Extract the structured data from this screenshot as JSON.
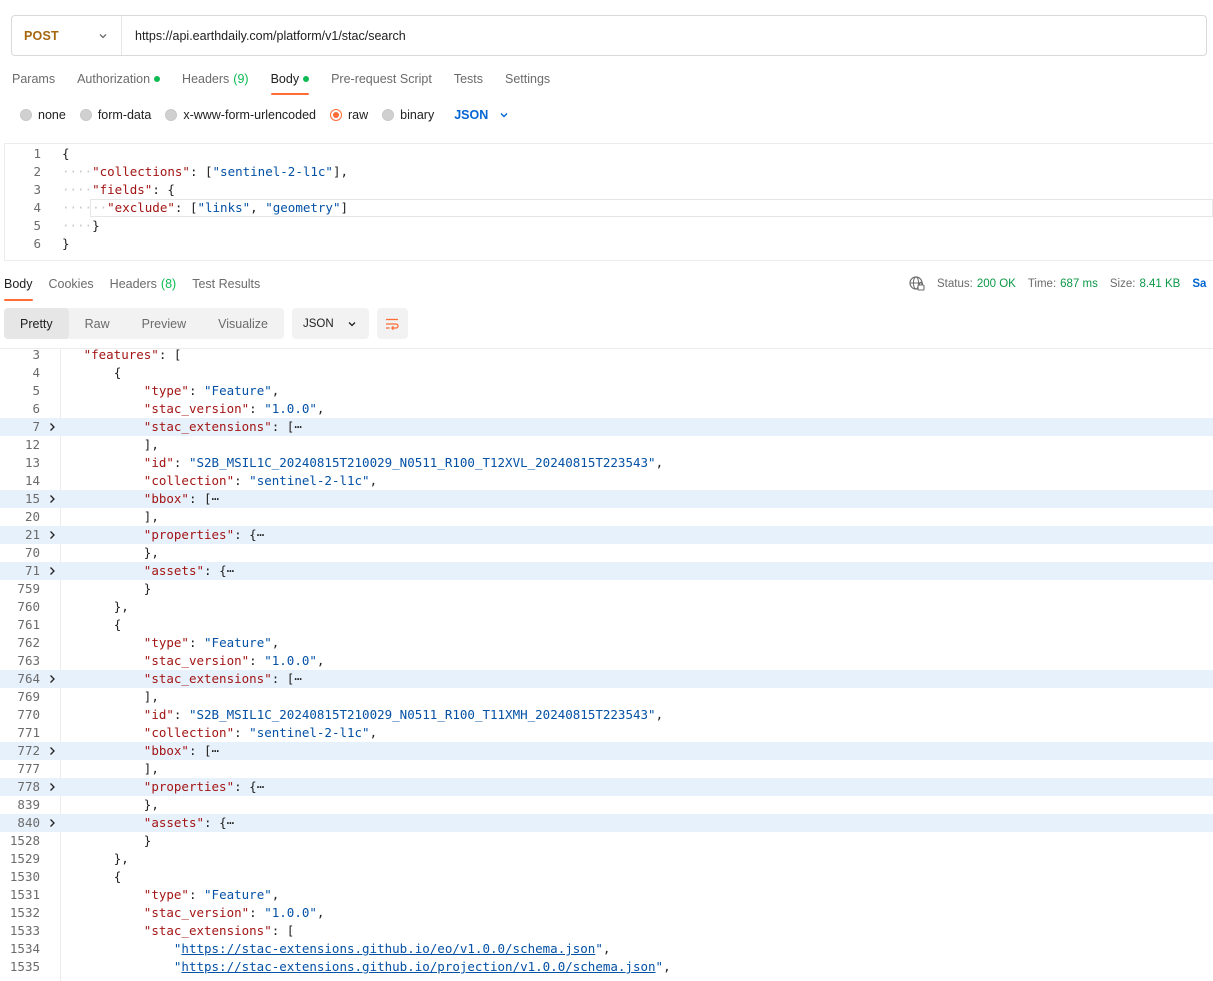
{
  "request": {
    "method": "POST",
    "url": "https://api.earthdaily.com/platform/v1/stac/search"
  },
  "request_tabs": [
    {
      "label": "Params",
      "count": "",
      "dot": false,
      "active": false
    },
    {
      "label": "Authorization",
      "count": "",
      "dot": true,
      "active": false
    },
    {
      "label": "Headers",
      "count": "(9)",
      "dot": false,
      "active": false
    },
    {
      "label": "Body",
      "count": "",
      "dot": true,
      "active": true
    },
    {
      "label": "Pre-request Script",
      "count": "",
      "dot": false,
      "active": false
    },
    {
      "label": "Tests",
      "count": "",
      "dot": false,
      "active": false
    },
    {
      "label": "Settings",
      "count": "",
      "dot": false,
      "active": false
    }
  ],
  "body_types": [
    {
      "label": "none",
      "checked": false
    },
    {
      "label": "form-data",
      "checked": false
    },
    {
      "label": "x-www-form-urlencoded",
      "checked": false
    },
    {
      "label": "raw",
      "checked": true
    },
    {
      "label": "binary",
      "checked": false
    }
  ],
  "body_format": "JSON",
  "request_body": [
    {
      "n": "1",
      "indent": 0,
      "tokens": [
        [
          "p",
          "{"
        ]
      ]
    },
    {
      "n": "2",
      "indent": 1,
      "tokens": [
        [
          "k",
          "\"collections\""
        ],
        [
          "p",
          ": ["
        ],
        [
          "s",
          "\"sentinel-2-l1c\""
        ],
        [
          "p",
          "],"
        ]
      ]
    },
    {
      "n": "3",
      "indent": 1,
      "tokens": [
        [
          "k",
          "\"fields\""
        ],
        [
          "p",
          ": {"
        ]
      ]
    },
    {
      "n": "4",
      "indent": 2,
      "tokens": [
        [
          "k",
          "\"exclude\""
        ],
        [
          "p",
          ": ["
        ],
        [
          "s",
          "\"links\""
        ],
        [
          "p",
          ", "
        ],
        [
          "s",
          "\"geometry\""
        ],
        [
          "p",
          "]"
        ]
      ]
    },
    {
      "n": "5",
      "indent": 1,
      "tokens": [
        [
          "p",
          "}"
        ]
      ]
    },
    {
      "n": "6",
      "indent": 0,
      "tokens": [
        [
          "p",
          "}"
        ]
      ]
    }
  ],
  "response_tabs": [
    {
      "label": "Body",
      "count": "",
      "active": true
    },
    {
      "label": "Cookies",
      "count": "",
      "active": false
    },
    {
      "label": "Headers",
      "count": "(8)",
      "active": false
    },
    {
      "label": "Test Results",
      "count": "",
      "active": false
    }
  ],
  "status": {
    "status_label": "Status:",
    "status_value": "200 OK",
    "time_label": "Time:",
    "time_value": "687 ms",
    "size_label": "Size:",
    "size_value": "8.41 KB",
    "save_label": "Sa"
  },
  "view_modes": [
    {
      "label": "Pretty",
      "active": true
    },
    {
      "label": "Raw",
      "active": false
    },
    {
      "label": "Preview",
      "active": false
    },
    {
      "label": "Visualize",
      "active": false
    }
  ],
  "response_format": "JSON",
  "response_body": [
    {
      "n": "3",
      "indent": 1,
      "fold": false,
      "tokens": [
        [
          "k",
          "\"features\""
        ],
        [
          "p",
          ": ["
        ]
      ]
    },
    {
      "n": "4",
      "indent": 2,
      "fold": false,
      "tokens": [
        [
          "p",
          "{"
        ]
      ]
    },
    {
      "n": "5",
      "indent": 3,
      "fold": false,
      "tokens": [
        [
          "k",
          "\"type\""
        ],
        [
          "p",
          ": "
        ],
        [
          "s",
          "\"Feature\""
        ],
        [
          "p",
          ","
        ]
      ]
    },
    {
      "n": "6",
      "indent": 3,
      "fold": false,
      "tokens": [
        [
          "k",
          "\"stac_version\""
        ],
        [
          "p",
          ": "
        ],
        [
          "s",
          "\"1.0.0\""
        ],
        [
          "p",
          ","
        ]
      ]
    },
    {
      "n": "7",
      "indent": 3,
      "fold": true,
      "tokens": [
        [
          "k",
          "\"stac_extensions\""
        ],
        [
          "p",
          ": ["
        ],
        [
          "e",
          "⋯"
        ]
      ]
    },
    {
      "n": "12",
      "indent": 3,
      "fold": false,
      "tokens": [
        [
          "p",
          "],"
        ]
      ]
    },
    {
      "n": "13",
      "indent": 3,
      "fold": false,
      "tokens": [
        [
          "k",
          "\"id\""
        ],
        [
          "p",
          ": "
        ],
        [
          "s",
          "\"S2B_MSIL1C_20240815T210029_N0511_R100_T12XVL_20240815T223543\""
        ],
        [
          "p",
          ","
        ]
      ]
    },
    {
      "n": "14",
      "indent": 3,
      "fold": false,
      "tokens": [
        [
          "k",
          "\"collection\""
        ],
        [
          "p",
          ": "
        ],
        [
          "s",
          "\"sentinel-2-l1c\""
        ],
        [
          "p",
          ","
        ]
      ]
    },
    {
      "n": "15",
      "indent": 3,
      "fold": true,
      "tokens": [
        [
          "k",
          "\"bbox\""
        ],
        [
          "p",
          ": ["
        ],
        [
          "e",
          "⋯"
        ]
      ]
    },
    {
      "n": "20",
      "indent": 3,
      "fold": false,
      "tokens": [
        [
          "p",
          "],"
        ]
      ]
    },
    {
      "n": "21",
      "indent": 3,
      "fold": true,
      "tokens": [
        [
          "k",
          "\"properties\""
        ],
        [
          "p",
          ": {"
        ],
        [
          "e",
          "⋯"
        ]
      ]
    },
    {
      "n": "70",
      "indent": 3,
      "fold": false,
      "tokens": [
        [
          "p",
          "},"
        ]
      ]
    },
    {
      "n": "71",
      "indent": 3,
      "fold": true,
      "tokens": [
        [
          "k",
          "\"assets\""
        ],
        [
          "p",
          ": {"
        ],
        [
          "e",
          "⋯"
        ]
      ]
    },
    {
      "n": "759",
      "indent": 3,
      "fold": false,
      "tokens": [
        [
          "p",
          "}"
        ]
      ]
    },
    {
      "n": "760",
      "indent": 2,
      "fold": false,
      "tokens": [
        [
          "p",
          "},"
        ]
      ]
    },
    {
      "n": "761",
      "indent": 2,
      "fold": false,
      "tokens": [
        [
          "p",
          "{"
        ]
      ]
    },
    {
      "n": "762",
      "indent": 3,
      "fold": false,
      "tokens": [
        [
          "k",
          "\"type\""
        ],
        [
          "p",
          ": "
        ],
        [
          "s",
          "\"Feature\""
        ],
        [
          "p",
          ","
        ]
      ]
    },
    {
      "n": "763",
      "indent": 3,
      "fold": false,
      "tokens": [
        [
          "k",
          "\"stac_version\""
        ],
        [
          "p",
          ": "
        ],
        [
          "s",
          "\"1.0.0\""
        ],
        [
          "p",
          ","
        ]
      ]
    },
    {
      "n": "764",
      "indent": 3,
      "fold": true,
      "tokens": [
        [
          "k",
          "\"stac_extensions\""
        ],
        [
          "p",
          ": ["
        ],
        [
          "e",
          "⋯"
        ]
      ]
    },
    {
      "n": "769",
      "indent": 3,
      "fold": false,
      "tokens": [
        [
          "p",
          "],"
        ]
      ]
    },
    {
      "n": "770",
      "indent": 3,
      "fold": false,
      "tokens": [
        [
          "k",
          "\"id\""
        ],
        [
          "p",
          ": "
        ],
        [
          "s",
          "\"S2B_MSIL1C_20240815T210029_N0511_R100_T11XMH_20240815T223543\""
        ],
        [
          "p",
          ","
        ]
      ]
    },
    {
      "n": "771",
      "indent": 3,
      "fold": false,
      "tokens": [
        [
          "k",
          "\"collection\""
        ],
        [
          "p",
          ": "
        ],
        [
          "s",
          "\"sentinel-2-l1c\""
        ],
        [
          "p",
          ","
        ]
      ]
    },
    {
      "n": "772",
      "indent": 3,
      "fold": true,
      "tokens": [
        [
          "k",
          "\"bbox\""
        ],
        [
          "p",
          ": ["
        ],
        [
          "e",
          "⋯"
        ]
      ]
    },
    {
      "n": "777",
      "indent": 3,
      "fold": false,
      "tokens": [
        [
          "p",
          "],"
        ]
      ]
    },
    {
      "n": "778",
      "indent": 3,
      "fold": true,
      "tokens": [
        [
          "k",
          "\"properties\""
        ],
        [
          "p",
          ": {"
        ],
        [
          "e",
          "⋯"
        ]
      ]
    },
    {
      "n": "839",
      "indent": 3,
      "fold": false,
      "tokens": [
        [
          "p",
          "},"
        ]
      ]
    },
    {
      "n": "840",
      "indent": 3,
      "fold": true,
      "tokens": [
        [
          "k",
          "\"assets\""
        ],
        [
          "p",
          ": {"
        ],
        [
          "e",
          "⋯"
        ]
      ]
    },
    {
      "n": "1528",
      "indent": 3,
      "fold": false,
      "tokens": [
        [
          "p",
          "}"
        ]
      ]
    },
    {
      "n": "1529",
      "indent": 2,
      "fold": false,
      "tokens": [
        [
          "p",
          "},"
        ]
      ]
    },
    {
      "n": "1530",
      "indent": 2,
      "fold": false,
      "tokens": [
        [
          "p",
          "{"
        ]
      ]
    },
    {
      "n": "1531",
      "indent": 3,
      "fold": false,
      "tokens": [
        [
          "k",
          "\"type\""
        ],
        [
          "p",
          ": "
        ],
        [
          "s",
          "\"Feature\""
        ],
        [
          "p",
          ","
        ]
      ]
    },
    {
      "n": "1532",
      "indent": 3,
      "fold": false,
      "tokens": [
        [
          "k",
          "\"stac_version\""
        ],
        [
          "p",
          ": "
        ],
        [
          "s",
          "\"1.0.0\""
        ],
        [
          "p",
          ","
        ]
      ]
    },
    {
      "n": "1533",
      "indent": 3,
      "fold": false,
      "tokens": [
        [
          "k",
          "\"stac_extensions\""
        ],
        [
          "p",
          ": ["
        ]
      ]
    },
    {
      "n": "1534",
      "indent": 4,
      "fold": false,
      "tokens": [
        [
          "s",
          "\""
        ],
        [
          "l",
          "https://stac-extensions.github.io/eo/v1.0.0/schema.json"
        ],
        [
          "s",
          "\""
        ],
        [
          "p",
          ","
        ]
      ]
    },
    {
      "n": "1535",
      "indent": 4,
      "fold": false,
      "tokens": [
        [
          "s",
          "\""
        ],
        [
          "l",
          "https://stac-extensions.github.io/projection/v1.0.0/schema.json"
        ],
        [
          "s",
          "\""
        ],
        [
          "p",
          ","
        ]
      ]
    }
  ],
  "colors": {
    "accent": "#ff6c37",
    "key": "#a31515",
    "string": "#0451a5",
    "success": "#0cbb52",
    "method": "#a6660d"
  }
}
